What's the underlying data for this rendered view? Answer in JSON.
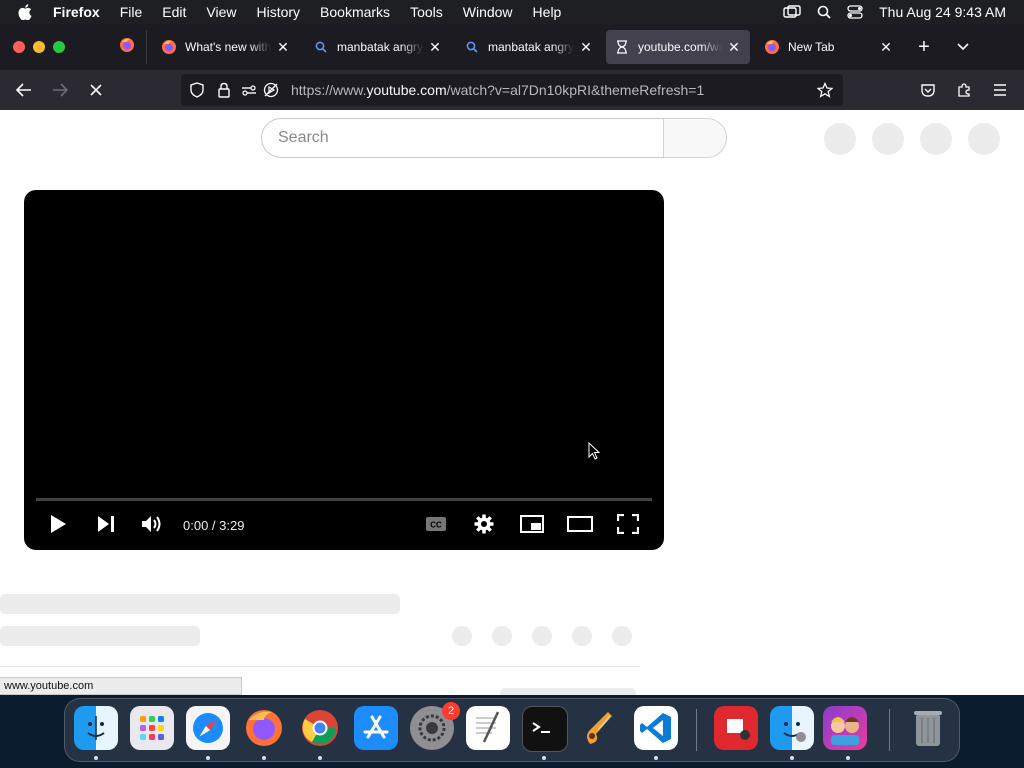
{
  "menubar": {
    "app_name": "Firefox",
    "items": [
      "File",
      "Edit",
      "View",
      "History",
      "Bookmarks",
      "Tools",
      "Window",
      "Help"
    ],
    "clock": "Thu Aug 24  9:43 AM"
  },
  "tabs": [
    {
      "label": "What's new with Firefox"
    },
    {
      "label": "manbatak angry"
    },
    {
      "label": "manbatak angry"
    },
    {
      "label": "youtube.com/watch"
    },
    {
      "label": "New Tab"
    }
  ],
  "navbar": {
    "url_prefix": "https://www.",
    "url_host": "youtube.com",
    "url_path": "/watch?v=al7Dn10kpRI&themeRefresh=1"
  },
  "page": {
    "search_placeholder": "Search",
    "player": {
      "time": "0:00 / 3:29",
      "progress": 0
    }
  },
  "status_bar": "www.youtube.com",
  "dock": {
    "apps": [
      "Finder",
      "Launchpad",
      "Safari",
      "Firefox",
      "Chrome",
      "App Store",
      "System Settings",
      "TextEdit",
      "Terminal",
      "GarageBand",
      "Visual Studio Code",
      "Photo Booth",
      "Finder Migration",
      "Game",
      "Trash"
    ],
    "settings_badge": "2"
  },
  "colors": {
    "menubar_bg": "#1e1f22",
    "tabstrip_bg": "#1c1b22",
    "active_tab_bg": "#42414d",
    "navbar_bg": "#2b2a33",
    "player_bg": "#000000"
  }
}
